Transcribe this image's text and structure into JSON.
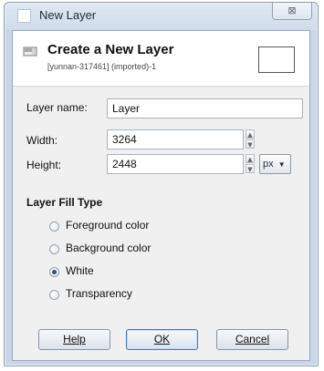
{
  "window": {
    "title": "New Layer",
    "close_glyph": "⊠"
  },
  "header": {
    "title": "Create a New Layer",
    "subtitle": "[yunnan-317461] (imported)-1",
    "icon": "layer-icon"
  },
  "form": {
    "layer_name_label": "Layer name:",
    "layer_name_value": "Layer",
    "width_label": "Width:",
    "width_value": "3264",
    "height_label": "Height:",
    "height_value": "2448",
    "unit_value": "px"
  },
  "fill_type": {
    "title": "Layer Fill Type",
    "options": [
      {
        "label": "Foreground color",
        "checked": false
      },
      {
        "label": "Background color",
        "checked": false
      },
      {
        "label": "White",
        "checked": true
      },
      {
        "label": "Transparency",
        "checked": false
      }
    ]
  },
  "buttons": {
    "help": "Help",
    "ok": "OK",
    "cancel": "Cancel"
  }
}
